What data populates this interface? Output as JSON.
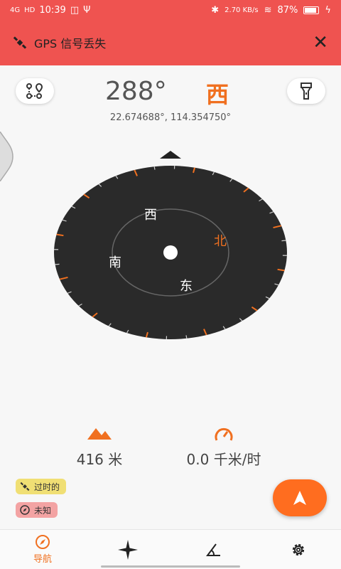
{
  "status_bar": {
    "network": "4G",
    "hd": "HD",
    "time": "10:39",
    "speed": "2.70 KB/s",
    "battery": "87%"
  },
  "banner": {
    "text": "GPS 信号丢失"
  },
  "heading": {
    "degrees": "288°",
    "direction": "西"
  },
  "location": {
    "coordinates": "22.674688°, 114.354750°"
  },
  "compass": {
    "heading_deg": 288,
    "labels": {
      "north": "北",
      "east": "东",
      "south": "南",
      "west": "西"
    }
  },
  "stats": {
    "altitude": "416 米",
    "speed": "0.0 千米/时"
  },
  "chips": {
    "outdated": "过时的",
    "unknown": "未知"
  },
  "nav": {
    "navigate_label": "导航"
  },
  "colors": {
    "accent": "#f07020",
    "banner": "#ef5350",
    "dial": "#2a2a2a"
  }
}
